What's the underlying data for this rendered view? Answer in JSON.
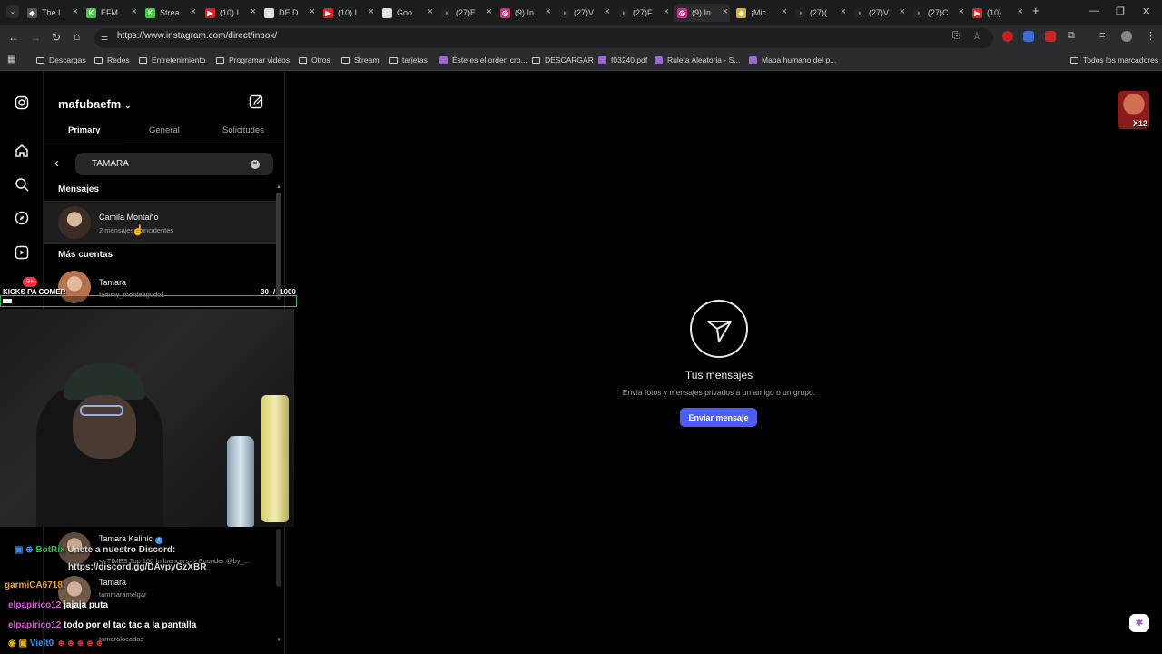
{
  "browser": {
    "tabs": [
      {
        "label": "The I",
        "color": "#555555",
        "glyph": "◆"
      },
      {
        "label": "EFM",
        "color": "#3bd13b",
        "glyph": "K"
      },
      {
        "label": "Strea",
        "color": "#3bd13b",
        "glyph": "K"
      },
      {
        "label": "(10) I",
        "color": "#e02020",
        "glyph": "▶"
      },
      {
        "label": "DE D",
        "color": "#dddddd",
        "glyph": "◐"
      },
      {
        "label": "(10) I",
        "color": "#e02020",
        "glyph": "▶"
      },
      {
        "label": "Goo",
        "color": "#dddddd",
        "glyph": "G"
      },
      {
        "label": "(27)E",
        "color": "#222222",
        "glyph": "♪"
      },
      {
        "label": "(9) In",
        "color": "#d62976",
        "glyph": "◎"
      },
      {
        "label": "(27)V",
        "color": "#222222",
        "glyph": "♪"
      },
      {
        "label": "(27)F",
        "color": "#222222",
        "glyph": "♪"
      },
      {
        "label": "(9) In",
        "color": "#d62976",
        "glyph": "◎"
      },
      {
        "label": "¡Mic",
        "color": "#e0b020",
        "glyph": "◆"
      },
      {
        "label": "(27)(",
        "color": "#222222",
        "glyph": "♪"
      },
      {
        "label": "(27)V",
        "color": "#222222",
        "glyph": "♪"
      },
      {
        "label": "(27)C",
        "color": "#222222",
        "glyph": "♪"
      },
      {
        "label": "(10)",
        "color": "#e02020",
        "glyph": "▶"
      }
    ],
    "active_tab_index": 11,
    "new_tab": "+",
    "url": "https://www.instagram.com/direct/inbox/",
    "bookmarks": [
      {
        "label": "Descargas",
        "type": "folder"
      },
      {
        "label": "Redes",
        "type": "folder"
      },
      {
        "label": "Entretenimiento",
        "type": "folder"
      },
      {
        "label": "Programar videos",
        "type": "folder"
      },
      {
        "label": "Otros",
        "type": "folder"
      },
      {
        "label": "Stream",
        "type": "folder"
      },
      {
        "label": "tarjetas",
        "type": "folder"
      },
      {
        "label": "Éste es el orden cro...",
        "type": "page"
      },
      {
        "label": "DESCARGAR",
        "type": "folder"
      },
      {
        "label": "f03240.pdf",
        "type": "page"
      },
      {
        "label": "Ruleta Aleatoria - S...",
        "type": "page"
      },
      {
        "label": "Mapa humano del p...",
        "type": "page"
      }
    ],
    "all_bookmarks": "Todos los marcadores"
  },
  "instagram": {
    "username": "mafubaefm",
    "tabs": [
      "Primary",
      "General",
      "Solicitudes"
    ],
    "search_value": "TAMARA",
    "section_messages": "Mensajes",
    "section_accounts": "Más cuentas",
    "results": [
      {
        "name": "Camila Montaño",
        "sub": "2 mensajes coincidentes",
        "avatar_color": "#6b5a4e"
      },
      {
        "name": "Tamara",
        "sub": "tammy_monteagudo1",
        "avatar_color": "#a86c52"
      },
      {
        "name": "Tamara Kalinic",
        "sub": "<<TIMES Top 100 Influencers>> Founder @by_...",
        "avatar_color": "#7a6a5a"
      },
      {
        "name": "Tamara",
        "sub": "tammaramelgar",
        "avatar_color": "#8a7765"
      },
      {
        "name": "",
        "sub": "tamaralocadas",
        "avatar_color": "#5a4a42"
      }
    ],
    "empty_title": "Tus mensajes",
    "empty_subtitle": "Envía fotos y mensajes privados a un amigo o un grupo.",
    "send_button": "Enviar mensaje",
    "notification_badge": "9+"
  },
  "stream_overlay": {
    "goal_label": "KICKS PA COMER",
    "goal_current": "30",
    "goal_separator": "/",
    "goal_total": "1000",
    "goal_progress": 0.03,
    "chat": [
      {
        "user": "BotRix",
        "user_color": "#2fbf4a",
        "text": "Unete a nuestro Discord:"
      },
      {
        "user": "",
        "user_color": "#ffffff",
        "text": "https://discord.gg/DAvpyGzXBR"
      },
      {
        "user": "garmiCA6718",
        "user_color": "#e7a23a",
        "text": ""
      },
      {
        "user": "elpapirico12",
        "user_color": "#d65ad6",
        "text": "jajaja puta"
      },
      {
        "user": "elpapirico12",
        "user_color": "#d65ad6",
        "text": "todo por el tac tac a la pantalla"
      },
      {
        "user": "Vielt0",
        "user_color": "#3a8ee7",
        "text": ""
      }
    ],
    "x12_badge": "X12"
  }
}
